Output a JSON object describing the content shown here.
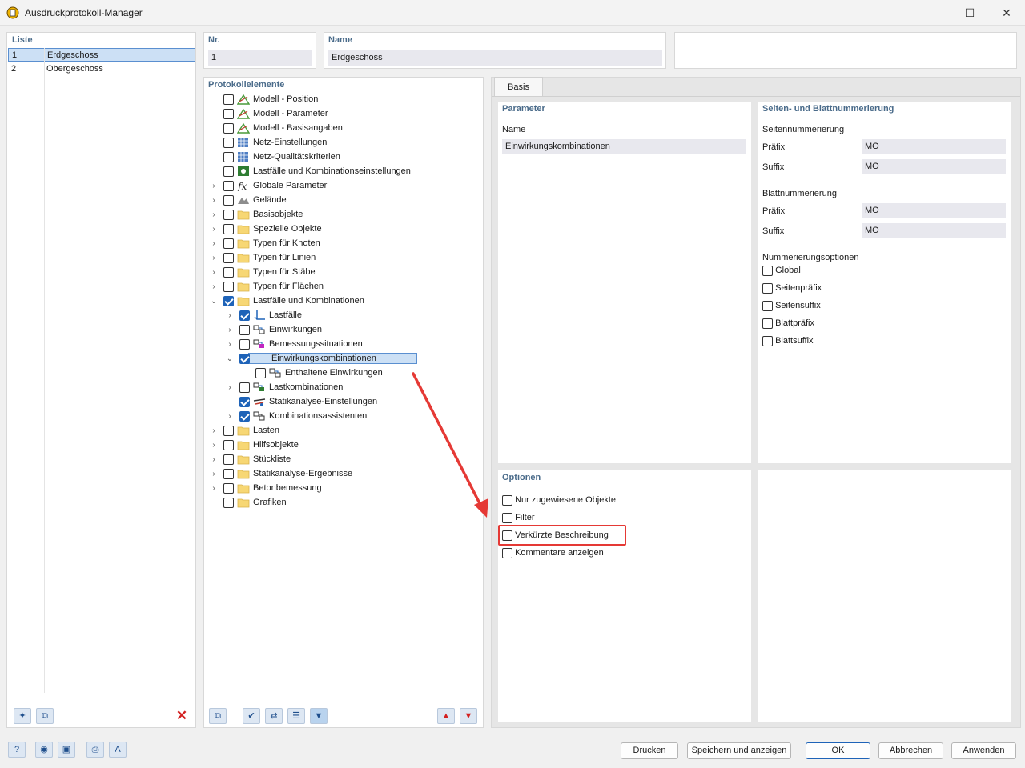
{
  "window": {
    "title": "Ausdruckprotokoll-Manager"
  },
  "list": {
    "header": "Liste",
    "items": [
      {
        "nr": "1",
        "name": "Erdgeschoss",
        "selected": true
      },
      {
        "nr": "2",
        "name": "Obergeschoss",
        "selected": false
      }
    ]
  },
  "nr": {
    "label": "Nr.",
    "value": "1"
  },
  "name": {
    "label": "Name",
    "value": "Erdgeschoss"
  },
  "tree": {
    "header": "Protokollelemente",
    "items": [
      {
        "label": "Modell - Position",
        "checked": false,
        "expand": "",
        "indent": 0,
        "icon": "model-icon"
      },
      {
        "label": "Modell - Parameter",
        "checked": false,
        "expand": "",
        "indent": 0,
        "icon": "model-icon"
      },
      {
        "label": "Modell - Basisangaben",
        "checked": false,
        "expand": "",
        "indent": 0,
        "icon": "model-icon"
      },
      {
        "label": "Netz-Einstellungen",
        "checked": false,
        "expand": "",
        "indent": 0,
        "icon": "mesh-icon"
      },
      {
        "label": "Netz-Qualitätskriterien",
        "checked": false,
        "expand": "",
        "indent": 0,
        "icon": "mesh-icon"
      },
      {
        "label": "Lastfälle und Kombinationseinstellungen",
        "checked": false,
        "expand": "",
        "indent": 0,
        "icon": "settings-icon"
      },
      {
        "label": "Globale Parameter",
        "checked": false,
        "expand": "›",
        "indent": 0,
        "icon": "fx-icon"
      },
      {
        "label": "Gelände",
        "checked": false,
        "expand": "›",
        "indent": 0,
        "icon": "terrain-icon"
      },
      {
        "label": "Basisobjekte",
        "checked": false,
        "expand": "›",
        "indent": 0,
        "icon": "folder-icon"
      },
      {
        "label": "Spezielle Objekte",
        "checked": false,
        "expand": "›",
        "indent": 0,
        "icon": "folder-icon"
      },
      {
        "label": "Typen für Knoten",
        "checked": false,
        "expand": "›",
        "indent": 0,
        "icon": "folder-icon"
      },
      {
        "label": "Typen für Linien",
        "checked": false,
        "expand": "›",
        "indent": 0,
        "icon": "folder-icon"
      },
      {
        "label": "Typen für Stäbe",
        "checked": false,
        "expand": "›",
        "indent": 0,
        "icon": "folder-icon"
      },
      {
        "label": "Typen für Flächen",
        "checked": false,
        "expand": "›",
        "indent": 0,
        "icon": "folder-icon"
      },
      {
        "label": "Lastfälle und Kombinationen",
        "checked": true,
        "expand": "⌄",
        "indent": 0,
        "icon": "folder-icon"
      },
      {
        "label": "Lastfälle",
        "checked": true,
        "expand": "›",
        "indent": 1,
        "icon": "loadcase-icon"
      },
      {
        "label": "Einwirkungen",
        "checked": false,
        "expand": "›",
        "indent": 1,
        "icon": "action-icon"
      },
      {
        "label": "Bemessungssituationen",
        "checked": false,
        "expand": "›",
        "indent": 1,
        "icon": "design-situation-icon"
      },
      {
        "label": "Einwirkungskombinationen",
        "checked": true,
        "expand": "⌄",
        "indent": 1,
        "icon": "action-combination-icon",
        "selected": true
      },
      {
        "label": "Enthaltene Einwirkungen",
        "checked": false,
        "expand": "",
        "indent": 2,
        "icon": "action-icon"
      },
      {
        "label": "Lastkombinationen",
        "checked": false,
        "expand": "›",
        "indent": 1,
        "icon": "load-combination-icon"
      },
      {
        "label": "Statikanalyse-Einstellungen",
        "checked": true,
        "expand": "",
        "indent": 1,
        "icon": "analysis-settings-icon"
      },
      {
        "label": "Kombinationsassistenten",
        "checked": true,
        "expand": "›",
        "indent": 1,
        "icon": "combination-wizard-icon"
      },
      {
        "label": "Lasten",
        "checked": false,
        "expand": "›",
        "indent": 0,
        "icon": "folder-icon"
      },
      {
        "label": "Hilfsobjekte",
        "checked": false,
        "expand": "›",
        "indent": 0,
        "icon": "folder-icon"
      },
      {
        "label": "Stückliste",
        "checked": false,
        "expand": "›",
        "indent": 0,
        "icon": "folder-icon"
      },
      {
        "label": "Statikanalyse-Ergebnisse",
        "checked": false,
        "expand": "›",
        "indent": 0,
        "icon": "folder-icon"
      },
      {
        "label": "Betonbemessung",
        "checked": false,
        "expand": "›",
        "indent": 0,
        "icon": "folder-icon"
      },
      {
        "label": "Grafiken",
        "checked": false,
        "expand": "",
        "indent": 0,
        "icon": "folder-icon"
      }
    ]
  },
  "tabs": {
    "basis": "Basis"
  },
  "parameter": {
    "header": "Parameter",
    "name_label": "Name",
    "name_value": "Einwirkungskombinationen"
  },
  "numbering": {
    "header": "Seiten- und Blattnummerierung",
    "page_header": "Seitennummerierung",
    "page_prefix_label": "Präfix",
    "page_prefix_value": "MO",
    "page_suffix_label": "Suffix",
    "page_suffix_value": "MO",
    "sheet_header": "Blattnummerierung",
    "sheet_prefix_label": "Präfix",
    "sheet_prefix_value": "MO",
    "sheet_suffix_label": "Suffix",
    "sheet_suffix_value": "MO",
    "options_header": "Nummerierungsoptionen",
    "options": [
      "Global",
      "Seitenpräfix",
      "Seitensuffix",
      "Blattpräfix",
      "Blattsuffix"
    ]
  },
  "optionen": {
    "header": "Optionen",
    "items": [
      "Nur zugewiesene Objekte",
      "Filter",
      "Verkürzte Beschreibung",
      "Kommentare anzeigen"
    ]
  },
  "buttons": {
    "drucken": "Drucken",
    "speichern": "Speichern und anzeigen",
    "ok": "OK",
    "abbrechen": "Abbrechen",
    "anwenden": "Anwenden"
  },
  "colors": {
    "accent": "#1e63b8",
    "highlight": "#e53935",
    "header": "#4a6b8a",
    "selection": "#cce0f5"
  }
}
